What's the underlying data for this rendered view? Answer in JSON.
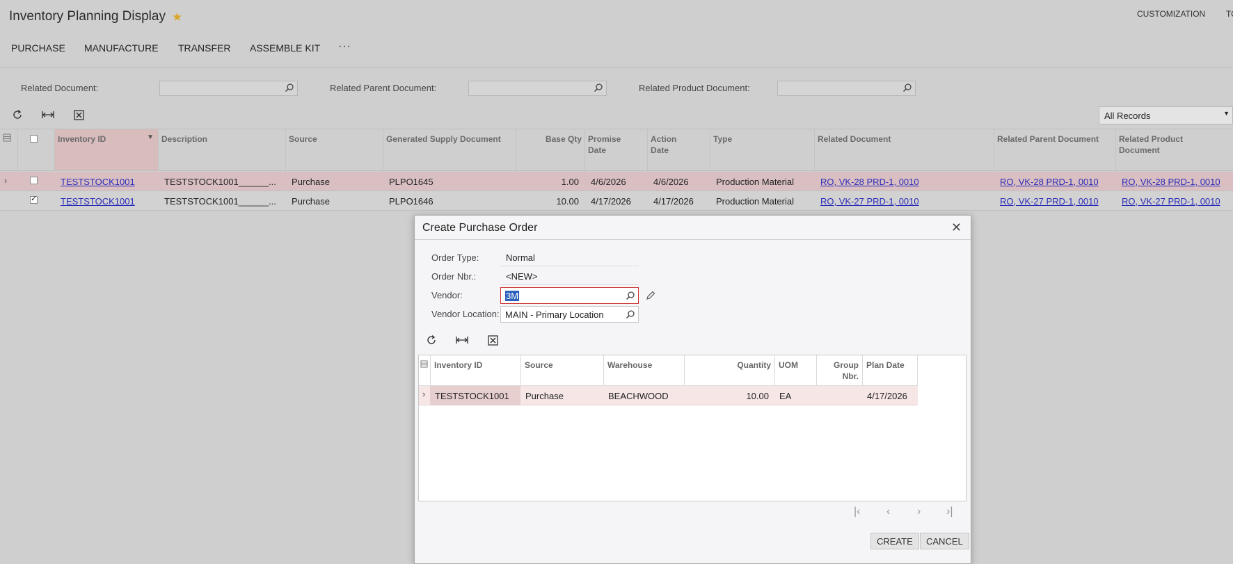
{
  "header": {
    "title": "Inventory Planning Display",
    "customization": "CUSTOMIZATION",
    "tools_cut": "TO"
  },
  "actions": [
    "PURCHASE",
    "MANUFACTURE",
    "TRANSFER",
    "ASSEMBLE KIT"
  ],
  "filters": {
    "related_document": "Related Document:",
    "related_parent_document": "Related Parent Document:",
    "related_product_document": "Related Product Document:"
  },
  "records_select": "All Records",
  "grid": {
    "columns": {
      "inventory_id": "Inventory ID",
      "description": "Description",
      "source": "Source",
      "generated_supply_document": "Generated Supply Document",
      "base_qty": "Base Qty",
      "promise_date": "Promise Date",
      "action_date": "Action Date",
      "type": "Type",
      "related_document": "Related Document",
      "related_parent_document": "Related Parent Document",
      "related_product_document": "Related Product Document"
    },
    "rows": [
      {
        "checked": false,
        "inventory_id": "TESTSTOCK1001",
        "description": "TESTSTOCK1001______...",
        "source": "Purchase",
        "supply_doc": "PLPO1645",
        "base_qty": "1.00",
        "promise_date": "4/6/2026",
        "action_date": "4/6/2026",
        "type": "Production Material",
        "related_doc": "RO, VK-28 PRD-1, 0010",
        "related_parent_doc": "RO, VK-28 PRD-1, 0010",
        "related_product_doc": "RO, VK-28 PRD-1, 0010"
      },
      {
        "checked": true,
        "inventory_id": "TESTSTOCK1001",
        "description": "TESTSTOCK1001______...",
        "source": "Purchase",
        "supply_doc": "PLPO1646",
        "base_qty": "10.00",
        "promise_date": "4/17/2026",
        "action_date": "4/17/2026",
        "type": "Production Material",
        "related_doc": "RO, VK-27 PRD-1, 0010",
        "related_parent_doc": "RO, VK-27 PRD-1, 0010",
        "related_product_doc": "RO, VK-27 PRD-1, 0010"
      }
    ]
  },
  "dialog": {
    "title": "Create Purchase Order",
    "order_type_label": "Order Type:",
    "order_type_value": "Normal",
    "order_nbr_label": "Order Nbr.:",
    "order_nbr_value": "<NEW>",
    "vendor_label": "Vendor:",
    "vendor_value": "3M",
    "vendor_location_label": "Vendor Location:",
    "vendor_location_value": "MAIN - Primary Location",
    "grid_columns": {
      "inventory_id": "Inventory ID",
      "source": "Source",
      "warehouse": "Warehouse",
      "quantity": "Quantity",
      "uom": "UOM",
      "group_nbr": "Group Nbr.",
      "plan_date": "Plan Date"
    },
    "grid_rows": [
      {
        "inventory_id": "TESTSTOCK1001",
        "source": "Purchase",
        "warehouse": "BEACHWOOD",
        "quantity": "10.00",
        "uom": "EA",
        "group_nbr": "",
        "plan_date": "4/17/2026"
      }
    ],
    "create_label": "CREATE",
    "cancel_label": "CANCEL"
  }
}
